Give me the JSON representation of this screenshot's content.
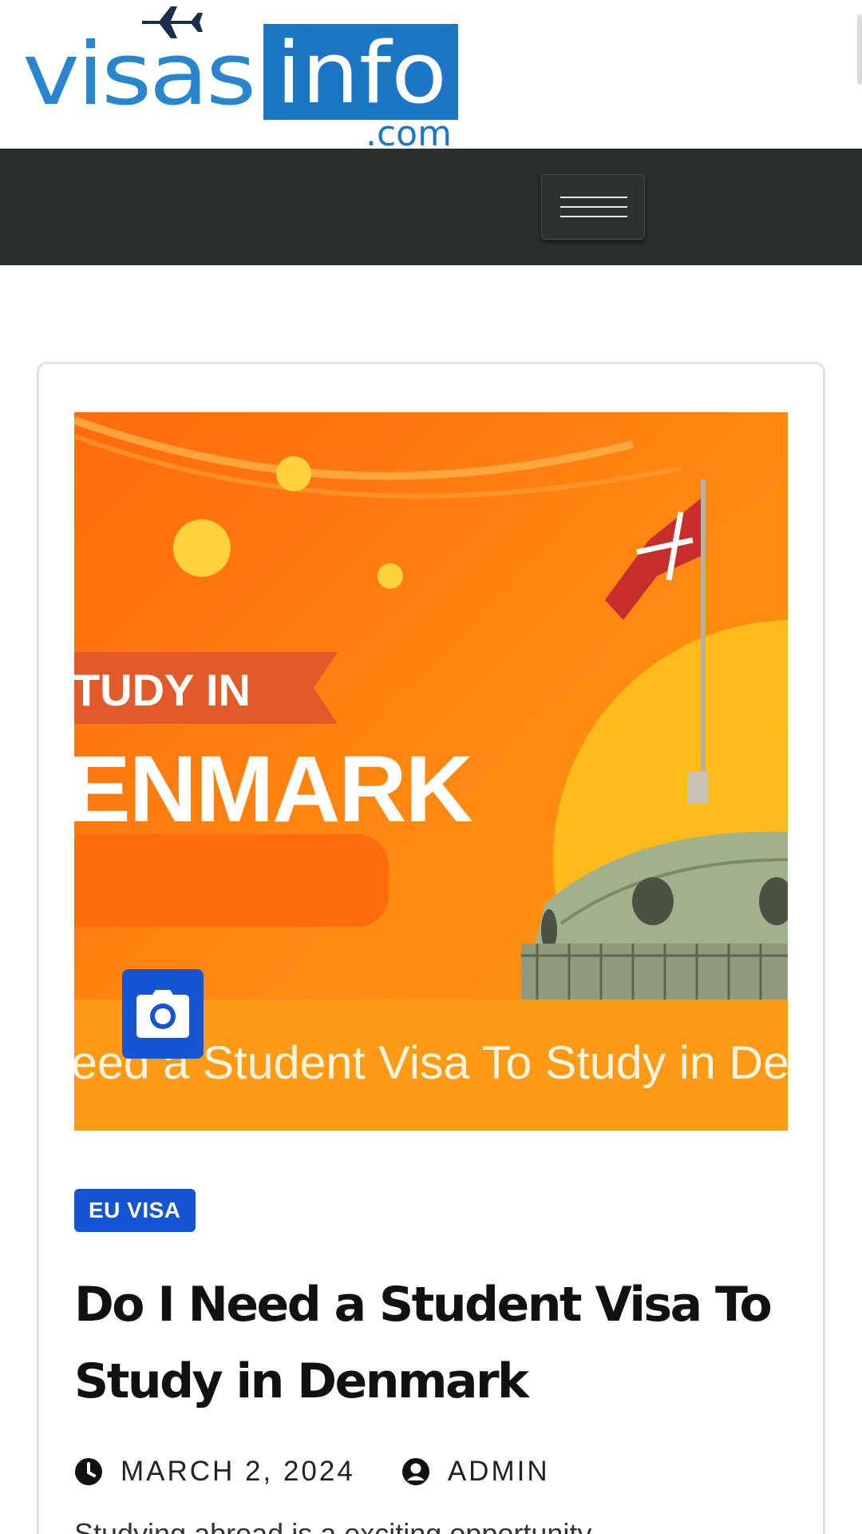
{
  "logo": {
    "word_left": "visas",
    "word_right": "info",
    "tld": ".com"
  },
  "nav": {
    "toggle_icon": "hamburger-icon"
  },
  "post": {
    "image": {
      "banner_top": "TUDY IN",
      "banner_main": "ENMARK",
      "banner_bottom": "eed a Student Visa To Study in De",
      "badge_icon": "camera-icon"
    },
    "category": "EU VISA",
    "title_line1": "Do I Need a Student Visa To",
    "title_line2": "Study in Denmark",
    "date": "MARCH 2, 2024",
    "author": "ADMIN",
    "excerpt": "Studying abroad is a exciting opportunity"
  },
  "colors": {
    "brand_blue": "#1B76C6",
    "accent_blue": "#1655D2",
    "nav_dark": "#2C2F30",
    "image_orange": "#FF7A10"
  }
}
